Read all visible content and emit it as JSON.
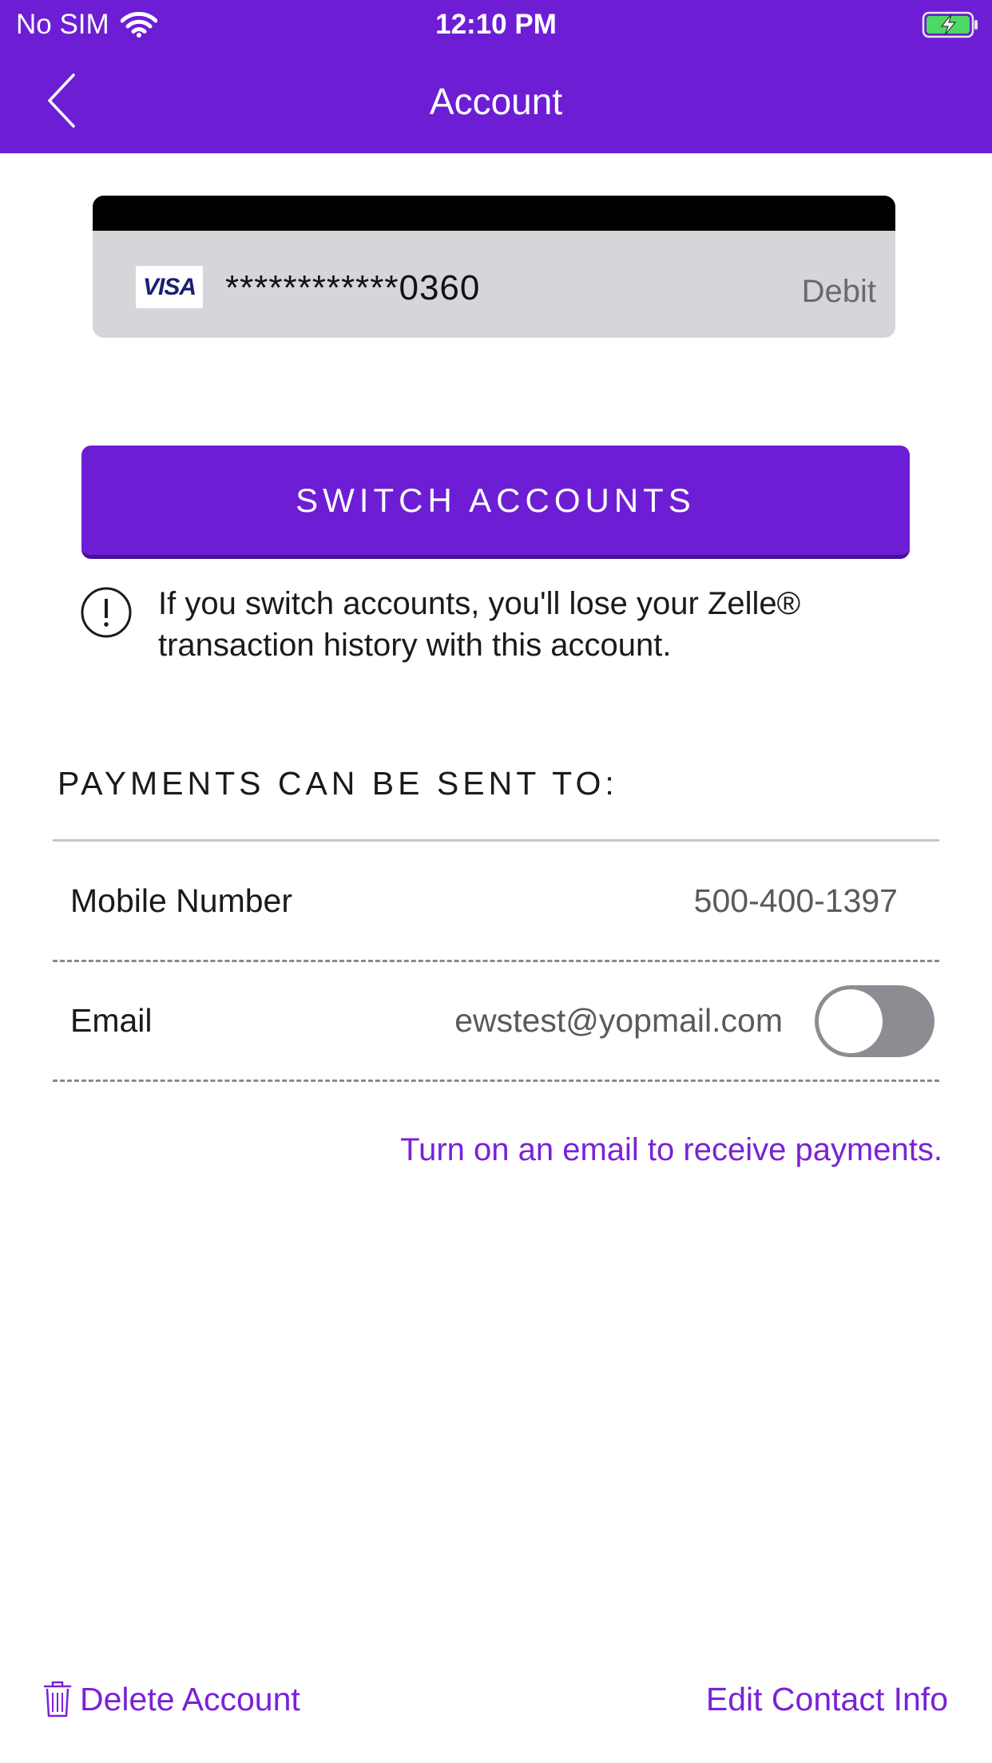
{
  "status_bar": {
    "carrier": "No SIM",
    "time": "12:10 PM"
  },
  "header": {
    "title": "Account"
  },
  "card": {
    "brand": "VISA",
    "masked_number": "************0360",
    "type": "Debit"
  },
  "switch_button": {
    "label": "SWITCH ACCOUNTS"
  },
  "warning": {
    "text": "If you switch accounts, you'll lose your Zelle® transaction history with this account."
  },
  "payments": {
    "section_title": "PAYMENTS CAN BE SENT TO:",
    "rows": [
      {
        "label": "Mobile Number",
        "value": "500-400-1397"
      },
      {
        "label": "Email",
        "value": "ewstest@yopmail.com",
        "toggle_on": false
      }
    ],
    "hint": "Turn on an email to receive payments."
  },
  "footer": {
    "delete_label": "Delete Account",
    "edit_label": "Edit Contact Info"
  },
  "colors": {
    "brand_purple": "#6d1ed4",
    "link_purple": "#7a22d6",
    "card_gray": "#d6d5da",
    "toggle_off": "#8e8c92",
    "battery_green": "#4cd964"
  }
}
